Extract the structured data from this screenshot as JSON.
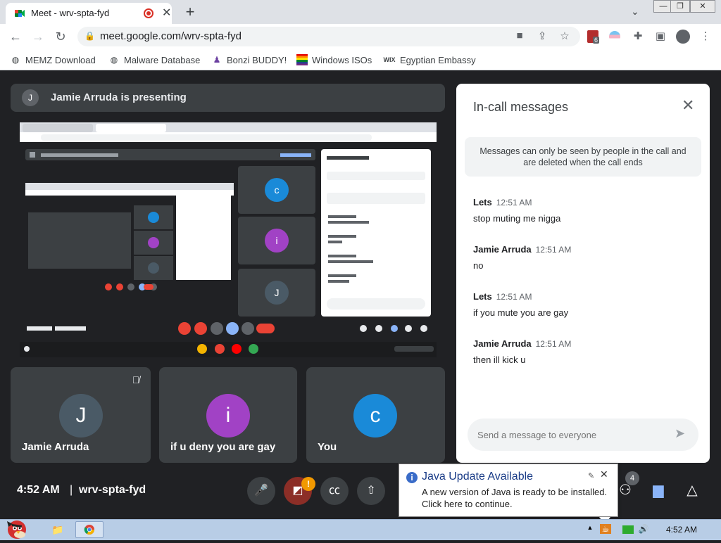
{
  "browser": {
    "tab_title": "Meet - wrv-spta-fyd",
    "tab_close": "✕",
    "new_tab": "+",
    "url": "meet.google.com/wrv-spta-fyd",
    "bookmarks": [
      {
        "label": "MEMZ Download",
        "icon": "globe-icon"
      },
      {
        "label": "Malware Database",
        "icon": "globe-icon"
      },
      {
        "label": "Bonzi BUDDY!",
        "icon": "bonzi-icon"
      },
      {
        "label": "Windows ISOs",
        "icon": "windows-flag-icon"
      },
      {
        "label": "Egyptian Embassy",
        "icon": "wix-icon"
      }
    ],
    "extension_badge": "6",
    "wix_text": "WIX"
  },
  "meet": {
    "presenting_avatar": "J",
    "presenting_text": "Jamie Arruda is presenting",
    "tiles": [
      {
        "name": "Jamie Arruda",
        "initial": "J",
        "color": "#4a5a66",
        "muted": true
      },
      {
        "name": "if u deny you are gay",
        "initial": "i",
        "color": "#a142c5",
        "muted": false
      },
      {
        "name": "You",
        "initial": "c",
        "color": "#1a8ad8",
        "muted": false
      }
    ],
    "clock": "4:52 AM",
    "separator": "|",
    "meeting_code": "wrv-spta-fyd",
    "camera_badge": "!",
    "participant_count": "4"
  },
  "chat": {
    "title": "In-call messages",
    "info": "Messages can only be seen by people in the call and are deleted when the call ends",
    "messages": [
      {
        "sender": "Lets",
        "time": "12:51 AM",
        "text": "stop muting me nigga"
      },
      {
        "sender": "Jamie Arruda",
        "time": "12:51 AM",
        "text": "no"
      },
      {
        "sender": "Lets",
        "time": "12:51 AM",
        "text": "if you mute you are gay"
      },
      {
        "sender": "Jamie Arruda",
        "time": "12:51 AM",
        "text": "then ill kick u"
      }
    ],
    "input_placeholder": "Send a message to everyone"
  },
  "java_popup": {
    "title": "Java Update Available",
    "line1": "A new version of Java is ready to be installed.",
    "line2": "Click here to continue."
  },
  "taskbar": {
    "time": "4:52 AM"
  },
  "colors": {
    "meet_bg": "#202124",
    "tile_bg": "#3c4043",
    "end_call": "#ea4335",
    "accent_blue": "#8ab4f8"
  }
}
